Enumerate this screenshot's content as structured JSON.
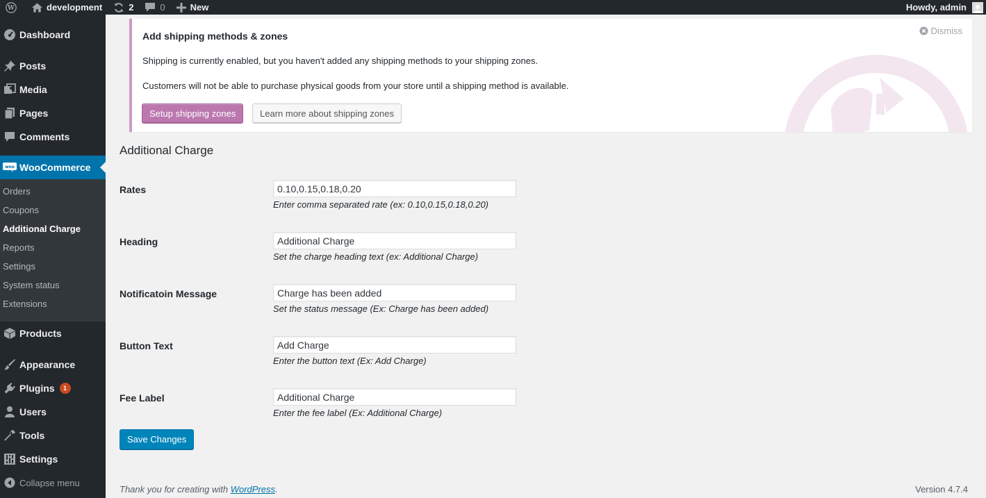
{
  "adminbar": {
    "site_name": "development",
    "updates_count": "2",
    "comments_count": "0",
    "new_label": "New",
    "greeting": "Howdy, admin"
  },
  "sidebar": {
    "top_items": [
      {
        "label": "Dashboard",
        "icon": "dashboard-icon"
      },
      {
        "label": "Posts",
        "icon": "pin-icon"
      },
      {
        "label": "Media",
        "icon": "media-icon"
      },
      {
        "label": "Pages",
        "icon": "pages-icon"
      },
      {
        "label": "Comments",
        "icon": "comment-icon"
      },
      {
        "label": "WooCommerce",
        "icon": "woo-icon"
      },
      {
        "label": "Products",
        "icon": "box-icon"
      },
      {
        "label": "Appearance",
        "icon": "brush-icon"
      },
      {
        "label": "Plugins",
        "icon": "plug-icon"
      },
      {
        "label": "Users",
        "icon": "user-icon"
      },
      {
        "label": "Tools",
        "icon": "wrench-icon"
      },
      {
        "label": "Settings",
        "icon": "sliders-icon"
      }
    ],
    "plugins_badge": "1",
    "submenu": [
      "Orders",
      "Coupons",
      "Additional Charge",
      "Reports",
      "Settings",
      "System status",
      "Extensions"
    ],
    "collapse_label": "Collapse menu"
  },
  "notice": {
    "title": "Add shipping methods & zones",
    "line1": "Shipping is currently enabled, but you haven't added any shipping methods to your shipping zones.",
    "line2": "Customers will not be able to purchase physical goods from your store until a shipping method is available.",
    "primary_button": "Setup shipping zones",
    "secondary_button": "Learn more about shipping zones",
    "dismiss": "Dismiss"
  },
  "form": {
    "title": "Additional Charge",
    "rows": [
      {
        "label": "Rates",
        "value": "0.10,0.15,0.18,0.20",
        "description": "Enter comma separated rate (ex: 0.10,0.15,0.18,0.20)"
      },
      {
        "label": "Heading",
        "value": "Additional Charge",
        "description": "Set the charge heading text (ex: Additional Charge)"
      },
      {
        "label": "Notificatoin Message",
        "value": "Charge has been added",
        "description": "Set the status message (Ex: Charge has been added)"
      },
      {
        "label": "Button Text",
        "value": "Add Charge",
        "description": "Enter the button text (Ex: Add Charge)"
      },
      {
        "label": "Fee Label",
        "value": "Additional Charge",
        "description": "Enter the fee label (Ex: Additional Charge)"
      }
    ],
    "save_label": "Save Changes"
  },
  "footer": {
    "thanks_prefix": "Thank you for creating with ",
    "wordpress_link": "WordPress",
    "thanks_suffix": ".",
    "version": "Version 4.7.4"
  },
  "colors": {
    "accent": "#0073aa",
    "woo_purple": "#bb77ae",
    "notice_border": "#cc99c2",
    "sidebar_bg": "#23282d"
  }
}
